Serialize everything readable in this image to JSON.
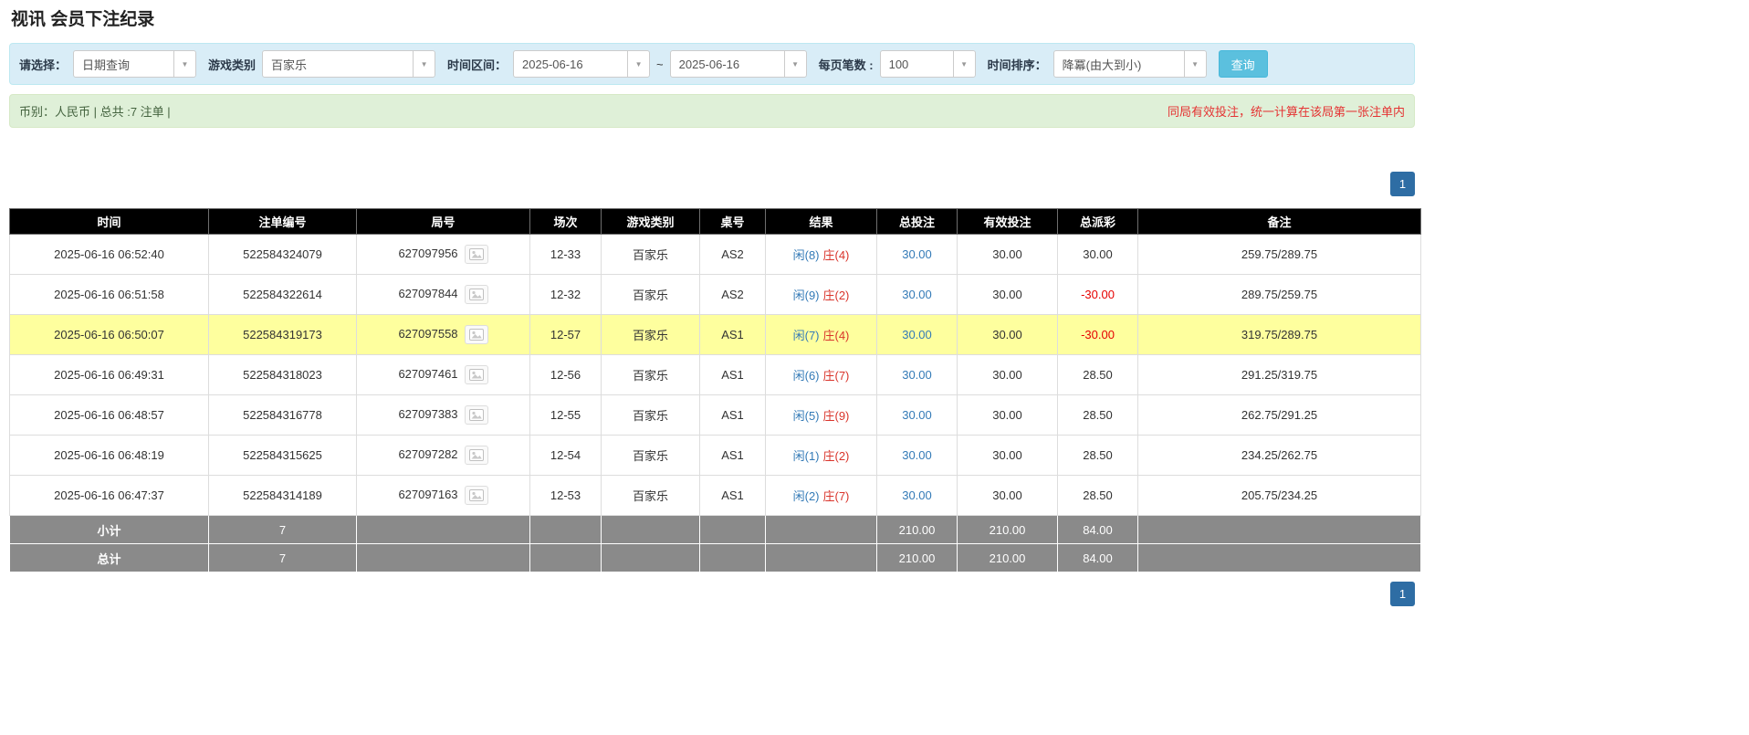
{
  "page_title": "视讯 会员下注纪录",
  "filters": {
    "select_label": "请选择：",
    "select_value": "日期查询",
    "game_type_label": "游戏类别",
    "game_type_value": "百家乐",
    "time_range_label": "时间区间：",
    "date_from": "2025-06-16",
    "tilde": "~",
    "date_to": "2025-06-16",
    "page_size_label": "每页笔数 :",
    "page_size_value": "100",
    "sort_label": "时间排序：",
    "sort_value": "降冪(由大到小)",
    "search_button": "查询"
  },
  "summary": {
    "left": "币别：人民币 | 总共 :7 注单 |",
    "right": "同局有效投注，统一计算在该局第一张注单内"
  },
  "pagination": {
    "page": "1"
  },
  "colors": {
    "link-blue": "#337ab7",
    "negative-red": "#e60000",
    "player-blue": "#337ab7",
    "banker-red": "#d9342b",
    "highlight-yellow": "#feff9e",
    "header-bg": "#000000",
    "footer-bg": "#8a8a8a",
    "filter-bg": "#d9edf7",
    "summary-bg": "#dff0d8",
    "query-btn": "#5bc0de",
    "pager-bg": "#2e6da4",
    "note-red": "#e53333"
  },
  "table": {
    "headers": [
      "时间",
      "注单编号",
      "局号",
      "场次",
      "游戏类别",
      "桌号",
      "结果",
      "总投注",
      "有效投注",
      "总派彩",
      "备注"
    ],
    "rows": [
      {
        "time": "2025-06-16 06:52:40",
        "bet_id": "522584324079",
        "round_id": "627097956",
        "session": "12-33",
        "game": "百家乐",
        "table_no": "AS2",
        "result_player": "闲(8)",
        "result_banker": "庄(4)",
        "total_bet": "30.00",
        "valid_bet": "30.00",
        "payout": "30.00",
        "note": "259.75/289.75",
        "highlight": false
      },
      {
        "time": "2025-06-16 06:51:58",
        "bet_id": "522584322614",
        "round_id": "627097844",
        "session": "12-32",
        "game": "百家乐",
        "table_no": "AS2",
        "result_player": "闲(9)",
        "result_banker": "庄(2)",
        "total_bet": "30.00",
        "valid_bet": "30.00",
        "payout": "-30.00",
        "note": "289.75/259.75",
        "highlight": false
      },
      {
        "time": "2025-06-16 06:50:07",
        "bet_id": "522584319173",
        "round_id": "627097558",
        "session": "12-57",
        "game": "百家乐",
        "table_no": "AS1",
        "result_player": "闲(7)",
        "result_banker": "庄(4)",
        "total_bet": "30.00",
        "valid_bet": "30.00",
        "payout": "-30.00",
        "note": "319.75/289.75",
        "highlight": true
      },
      {
        "time": "2025-06-16 06:49:31",
        "bet_id": "522584318023",
        "round_id": "627097461",
        "session": "12-56",
        "game": "百家乐",
        "table_no": "AS1",
        "result_player": "闲(6)",
        "result_banker": "庄(7)",
        "total_bet": "30.00",
        "valid_bet": "30.00",
        "payout": "28.50",
        "note": "291.25/319.75",
        "highlight": false
      },
      {
        "time": "2025-06-16 06:48:57",
        "bet_id": "522584316778",
        "round_id": "627097383",
        "session": "12-55",
        "game": "百家乐",
        "table_no": "AS1",
        "result_player": "闲(5)",
        "result_banker": "庄(9)",
        "total_bet": "30.00",
        "valid_bet": "30.00",
        "payout": "28.50",
        "note": "262.75/291.25",
        "highlight": false
      },
      {
        "time": "2025-06-16 06:48:19",
        "bet_id": "522584315625",
        "round_id": "627097282",
        "session": "12-54",
        "game": "百家乐",
        "table_no": "AS1",
        "result_player": "闲(1)",
        "result_banker": "庄(2)",
        "total_bet": "30.00",
        "valid_bet": "30.00",
        "payout": "28.50",
        "note": "234.25/262.75",
        "highlight": false
      },
      {
        "time": "2025-06-16 06:47:37",
        "bet_id": "522584314189",
        "round_id": "627097163",
        "session": "12-53",
        "game": "百家乐",
        "table_no": "AS1",
        "result_player": "闲(2)",
        "result_banker": "庄(7)",
        "total_bet": "30.00",
        "valid_bet": "30.00",
        "payout": "28.50",
        "note": "205.75/234.25",
        "highlight": false
      }
    ],
    "subtotal": {
      "label": "小计",
      "count": "7",
      "total_bet": "210.00",
      "valid_bet": "210.00",
      "payout": "84.00"
    },
    "total": {
      "label": "总计",
      "count": "7",
      "total_bet": "210.00",
      "valid_bet": "210.00",
      "payout": "84.00"
    }
  }
}
